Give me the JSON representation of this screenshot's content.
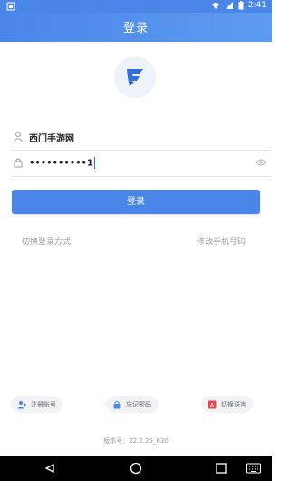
{
  "status_bar": {
    "time": "2:41"
  },
  "header": {
    "title": "登录"
  },
  "form": {
    "username_value": "西门手游网",
    "password_masked": "••••••••••1"
  },
  "buttons": {
    "login_label": "登录",
    "switch_login_method": "切换登录方式",
    "change_phone": "修改手机号码"
  },
  "bottom_actions": {
    "register": "注册账号",
    "forgot_password": "忘记密码",
    "switch_language": "切换语言"
  },
  "footer": {
    "version": "版本号：22.2.25_630"
  },
  "colors": {
    "accent": "#4a86e8",
    "logo_blue": "#2f6fde"
  }
}
